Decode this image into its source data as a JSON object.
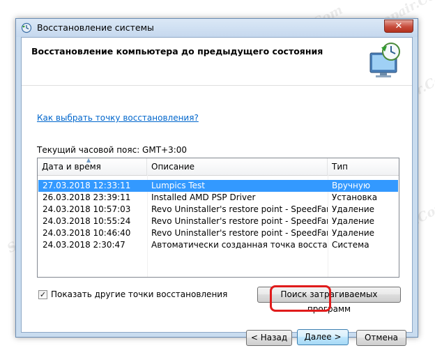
{
  "window": {
    "title": "Восстановление системы",
    "close_label": "✕",
    "header_title": "Восстановление компьютера до предыдущего состояния"
  },
  "help_link": "Как выбрать точку восстановления?",
  "timezone_label": "Текущий часовой пояс: GMT+3:00",
  "table": {
    "columns": [
      "Дата и время",
      "Описание",
      "Тип"
    ],
    "rows": [
      {
        "date": "27.03.2018 12:33:11",
        "desc": "Lumpics Test",
        "type": "Вручную"
      },
      {
        "date": "26.03.2018 23:39:11",
        "desc": "Installed AMD PSP Driver",
        "type": "Установка"
      },
      {
        "date": "24.03.2018 10:57:03",
        "desc": "Revo Uninstaller's restore point - SpeedFan (rem...",
        "type": "Удаление"
      },
      {
        "date": "24.03.2018 10:55:24",
        "desc": "Revo Uninstaller's restore point - SpeedFan (rem...",
        "type": "Удаление"
      },
      {
        "date": "24.03.2018 10:46:40",
        "desc": "Revo Uninstaller's restore point - SpeedFan (rem...",
        "type": "Удаление"
      },
      {
        "date": "24.03.2018 2:30:47",
        "desc": "Автоматически созданная точка восстановле...",
        "type": "Система"
      }
    ]
  },
  "show_more": {
    "label": "Показать другие точки восстановления",
    "checked": true
  },
  "buttons": {
    "scan": "Поиск затрагиваемых программ",
    "back": "< Назад",
    "next": "Далее >",
    "cancel": "Отмена"
  },
  "watermark": "Soringpcrepair.Com"
}
